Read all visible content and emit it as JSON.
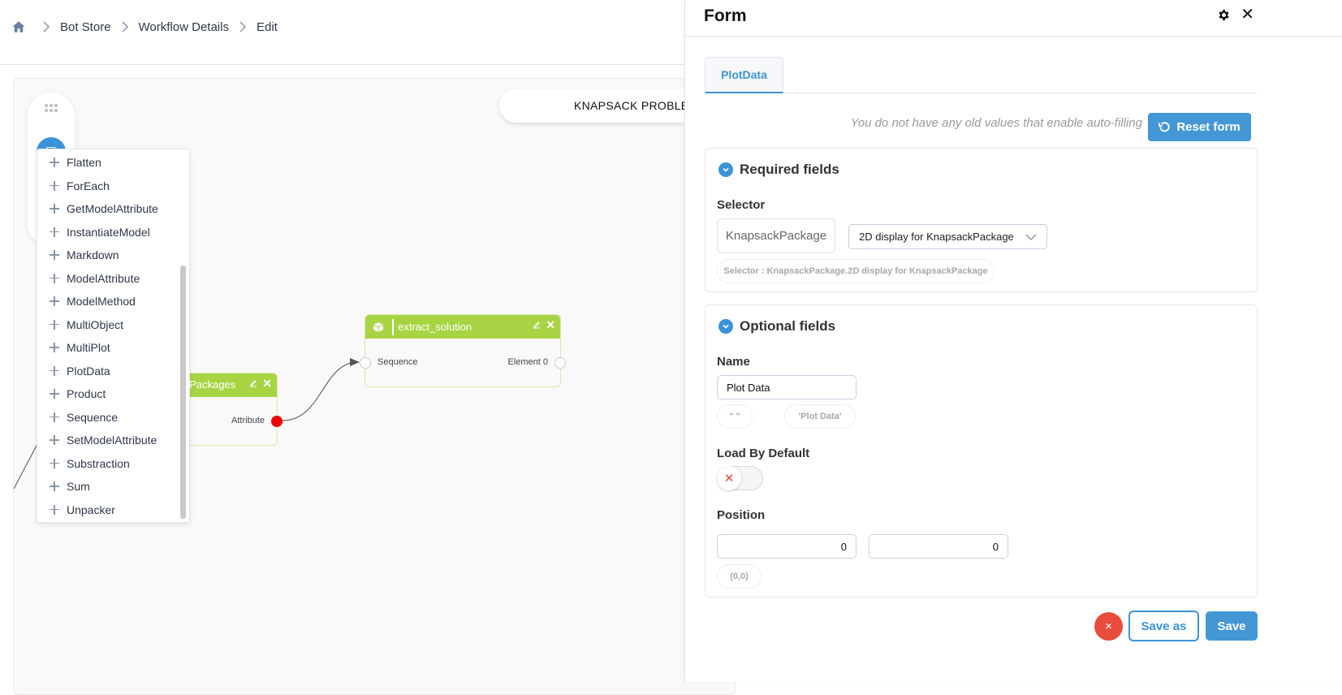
{
  "breadcrumb": {
    "home_icon": "home-icon",
    "items": [
      "Bot Store",
      "Workflow Details",
      "Edit"
    ]
  },
  "canvas": {
    "workflow_title": "KNAPSACK PROBLEM",
    "nodes": {
      "packages": {
        "title": "Knapsack Packages",
        "visible_title": "k Packages",
        "output_port": "Attribute"
      },
      "extract": {
        "title": "extract_solution",
        "input_port": "Sequence",
        "output_port": "Element 0"
      }
    }
  },
  "menu": {
    "items": [
      "Flatten",
      "ForEach",
      "GetModelAttribute",
      "InstantiateModel",
      "Markdown",
      "ModelAttribute",
      "ModelMethod",
      "MultiObject",
      "MultiPlot",
      "PlotData",
      "Product",
      "Sequence",
      "SetModelAttribute",
      "Substraction",
      "Sum",
      "Unpacker"
    ]
  },
  "panel": {
    "title": "Form",
    "tabs": [
      {
        "label": "PlotData",
        "active": true
      }
    ],
    "autofill_note": "You do not have any old values that enable auto-filling",
    "reset_label": "Reset form",
    "required": {
      "title": "Required fields",
      "selector_label": "Selector",
      "selector_class": "KnapsackPackage",
      "selector_value": "2D display for KnapsackPackage",
      "selector_summary": "Selector : KnapsackPackage.2D display for KnapsackPackage"
    },
    "optional": {
      "title": "Optional fields",
      "name_label": "Name",
      "name_value": "Plot Data",
      "name_default_pill": "\" \"",
      "name_value_pill": "'Plot Data'",
      "load_label": "Load By Default",
      "load_value": false,
      "position_label": "Position",
      "position_x": "0",
      "position_y": "0",
      "position_pill": "(0,0)"
    },
    "buttons": {
      "cancel": "×",
      "save_as": "Save as",
      "save": "Save"
    }
  },
  "colors": {
    "accent": "#3a93d8",
    "node_header": "#a8d444",
    "danger": "#e74c3c",
    "port_active": "#ee0000"
  }
}
